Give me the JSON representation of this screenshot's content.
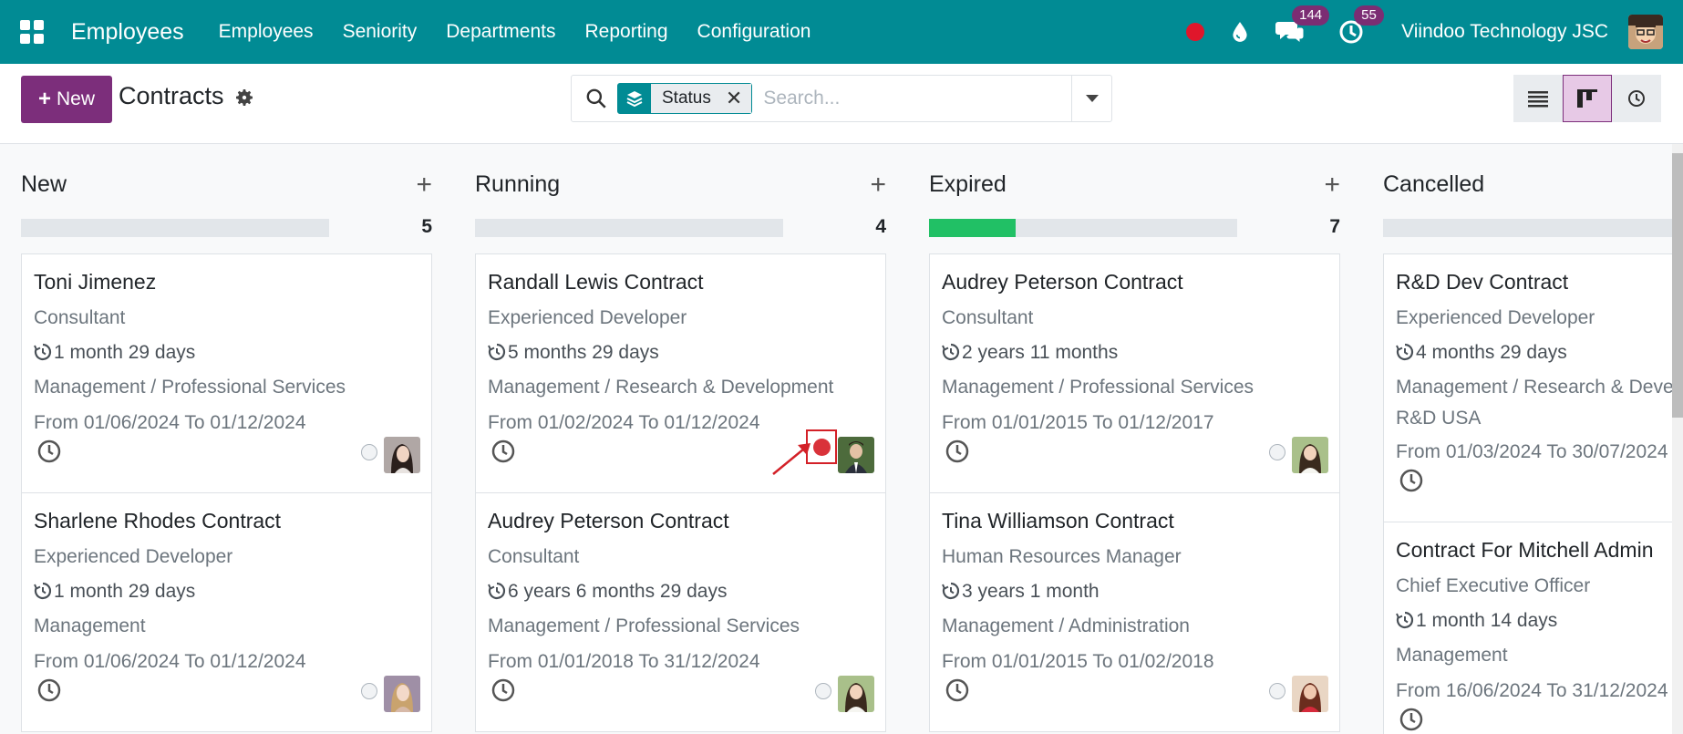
{
  "navbar": {
    "app_name": "Employees",
    "menu": [
      "Employees",
      "Seniority",
      "Departments",
      "Reporting",
      "Configuration"
    ],
    "messages_count": "144",
    "activities_count": "55",
    "company": "Viindoo Technology JSC"
  },
  "control_panel": {
    "new_label": "New",
    "title": "Contracts",
    "facet_label": "Status",
    "search_placeholder": "Search..."
  },
  "columns": [
    {
      "title": "New",
      "count": "5",
      "progress_fill": 0,
      "cards": [
        {
          "name": "Toni Jimenez",
          "job": "Consultant",
          "duration": "1 month 29 days",
          "department": [
            "Management / Professional Services"
          ],
          "dates": "From 01/06/2024 To 01/12/2024",
          "state": "normal",
          "avatar": "woman-dark-hair"
        },
        {
          "name": "Sharlene Rhodes Contract",
          "job": "Experienced Developer",
          "duration": "1 month 29 days",
          "department": [
            "Management"
          ],
          "dates": "From 01/06/2024 To 01/12/2024",
          "state": "normal",
          "avatar": "woman-light-hair"
        }
      ]
    },
    {
      "title": "Running",
      "count": "4",
      "progress_fill": 0,
      "cards": [
        {
          "name": "Randall Lewis Contract",
          "job": "Experienced Developer",
          "duration": "5 months 29 days",
          "department": [
            "Management / Research & Development"
          ],
          "dates": "From 01/02/2024 To 01/12/2024",
          "state": "blocked",
          "avatar": "man-suit"
        },
        {
          "name": "Audrey Peterson Contract",
          "job": "Consultant",
          "duration": "6 years 6 months 29 days",
          "department": [
            "Management / Professional Services"
          ],
          "dates": "From 01/01/2018 To 31/12/2024",
          "state": "normal",
          "avatar": "woman-outdoor"
        }
      ]
    },
    {
      "title": "Expired",
      "count": "7",
      "progress_fill": 0.28,
      "cards": [
        {
          "name": "Audrey Peterson Contract",
          "job": "Consultant",
          "duration": "2 years 11 months",
          "department": [
            "Management / Professional Services"
          ],
          "dates": "From 01/01/2015 To 01/12/2017",
          "state": "normal",
          "avatar": "woman-outdoor"
        },
        {
          "name": "Tina Williamson Contract",
          "job": "Human Resources Manager",
          "duration": "3 years 1 month",
          "department": [
            "Management / Administration"
          ],
          "dates": "From 01/01/2015 To 01/02/2018",
          "state": "normal",
          "avatar": "woman-red"
        }
      ]
    },
    {
      "title": "Cancelled",
      "count": "",
      "progress_fill": 0,
      "cards": [
        {
          "name": "R&D Dev Contract",
          "job": "Experienced Developer",
          "duration": "4 months 29 days",
          "department": [
            "Management / Research & Development",
            "R&D USA"
          ],
          "dates": "From 01/03/2024 To 30/07/2024",
          "state": "none",
          "avatar": ""
        },
        {
          "name": "Contract For Mitchell Admin",
          "job": "Chief Executive Officer",
          "duration": "1 month 14 days",
          "department": [
            "Management"
          ],
          "dates": "From 16/06/2024 To 31/12/2024",
          "state": "none",
          "avatar": ""
        }
      ]
    }
  ],
  "colors": {
    "brand": "#018b94",
    "primary": "#7c2e7b",
    "success": "#21c065",
    "danger": "#d32027"
  }
}
